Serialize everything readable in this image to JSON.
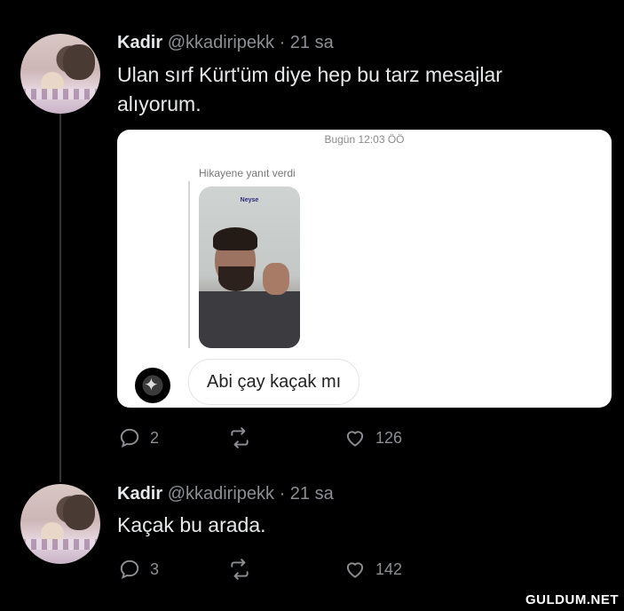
{
  "tweets": [
    {
      "name": "Kadir",
      "handle": "@kkadiripekk",
      "time": "· 21 sa",
      "text_line1": "Ulan sırf Kürt'üm diye hep bu tarz mesajlar",
      "text_line2": "alıyorum.",
      "card": {
        "date": "Bugün 12:03 ÖÖ",
        "story_label": "Hikayene yanıt verdi",
        "story_tag": "Neyse",
        "message": "Abi çay kaçak mı"
      },
      "actions": {
        "replies": "2",
        "retweets": "",
        "likes": "126"
      }
    },
    {
      "name": "Kadir",
      "handle": "@kkadiripekk",
      "time": "· 21 sa",
      "text_line1": "Kaçak bu arada.",
      "actions": {
        "replies": "3",
        "retweets": "",
        "likes": "142"
      }
    }
  ],
  "watermark": "GULDUM.NET",
  "icons": {
    "reply": "reply-icon",
    "retweet": "retweet-icon",
    "like": "heart-icon"
  }
}
